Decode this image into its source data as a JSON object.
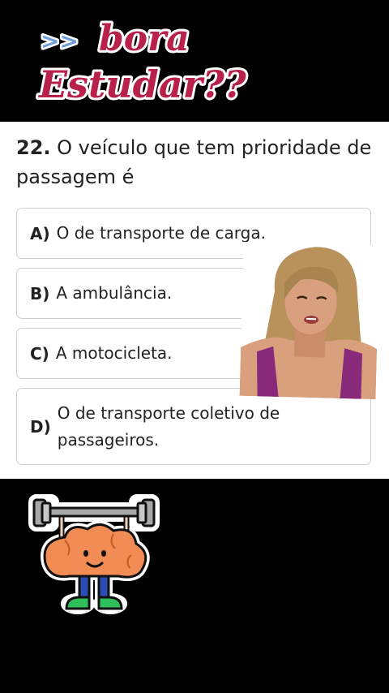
{
  "banner": {
    "arrow": ">>",
    "line1": "bora",
    "line2": "Estudar??"
  },
  "quiz": {
    "question_number": "22.",
    "question_text": "O veículo que tem prioridade de passagem é",
    "options": [
      {
        "letter": "A)",
        "text": "O de transporte de carga."
      },
      {
        "letter": "B)",
        "text": "A ambulância."
      },
      {
        "letter": "C)",
        "text": "A motocicleta."
      },
      {
        "letter": "D)",
        "text": "O de transporte coletivo de passageiros."
      }
    ]
  },
  "colors": {
    "sticker_magenta": "#b8224a",
    "arrow_blue": "#6f9fd8",
    "brain_orange": "#f28c55",
    "barbell_gray": "#a8a8a8",
    "shoe_green": "#2fbf5a",
    "legs_blue": "#2b4db3"
  },
  "icons": {
    "mascot": "brain-lifting-barbell-icon",
    "presenter": "presenter-video"
  }
}
